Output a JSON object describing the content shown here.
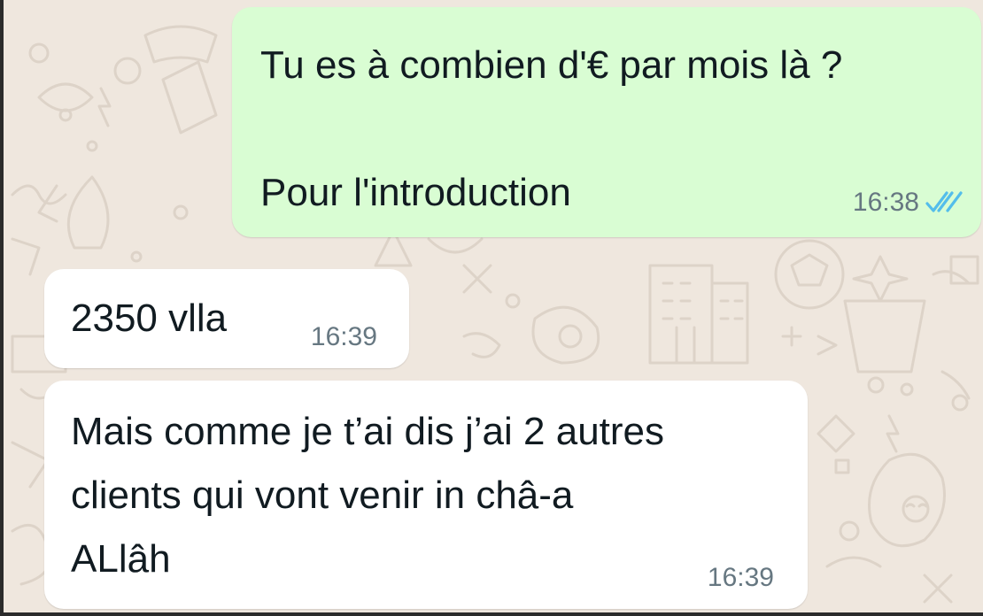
{
  "conversation": {
    "messages": [
      {
        "direction": "outgoing",
        "text": "Tu es à combien d'€ par mois là ?\n\nPour l'introduction",
        "time": "16:38",
        "status_icon": "double-check-read-icon",
        "status_color": "#53bdeb"
      },
      {
        "direction": "incoming",
        "text": "2350 vlla",
        "time": "16:39"
      },
      {
        "direction": "incoming",
        "text": "Mais comme je t’ai dis j’ai 2 autres\nclients qui vont venir in châ-a\nALlâh",
        "time": "16:39"
      }
    ]
  },
  "colors": {
    "background": "#efe7de",
    "outgoing_bubble": "#d9fdd3",
    "incoming_bubble": "#ffffff",
    "text": "#111b21",
    "timestamp": "#667781"
  }
}
